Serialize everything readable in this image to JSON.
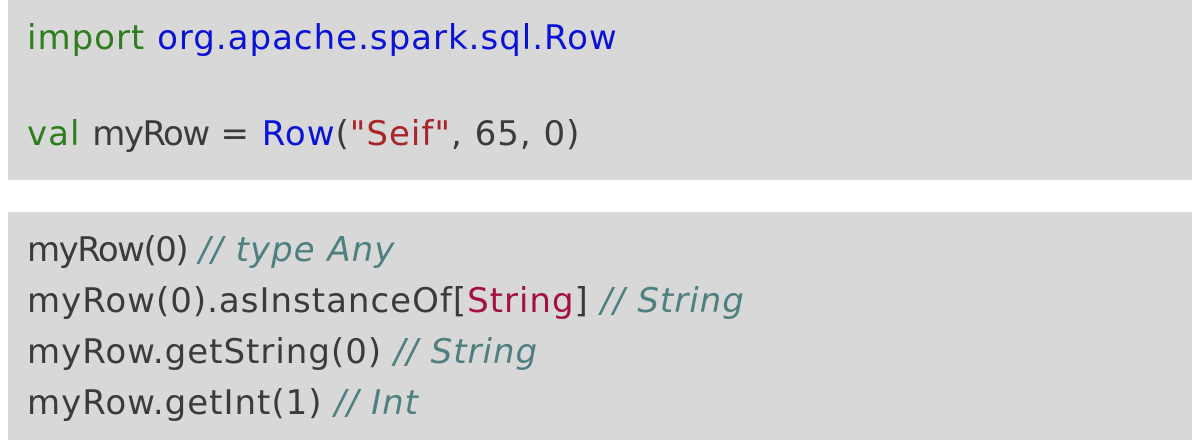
{
  "block1": {
    "line1": {
      "keyword": "import",
      "package": "org.apache.spark.sql.Row"
    },
    "line2": {
      "keyword": "val",
      "variable": "myRow",
      "equals": "=",
      "constructor": "Row",
      "open_paren": "(",
      "string_arg": "\"Seif\"",
      "rest_args": ", 65, 0)"
    }
  },
  "block2": {
    "line1": {
      "code": "myRow(0)",
      "comment": "// type Any"
    },
    "line2": {
      "code_prefix": "myRow(0).asInstanceOf[",
      "type_param": "String",
      "code_suffix": "]",
      "comment": "// String"
    },
    "line3": {
      "code": "myRow.getString(0)",
      "comment": "// String"
    },
    "line4": {
      "code": "myRow.getInt(1)",
      "comment": "// Int"
    }
  },
  "colors": {
    "background": "#d8d8d8",
    "keyword": "#2e7d1e",
    "identifier_blue": "#0a12d6",
    "string": "#a6262b",
    "type_param": "#a3123f",
    "comment": "#4f7f7f",
    "plain": "#3b3b3b"
  }
}
